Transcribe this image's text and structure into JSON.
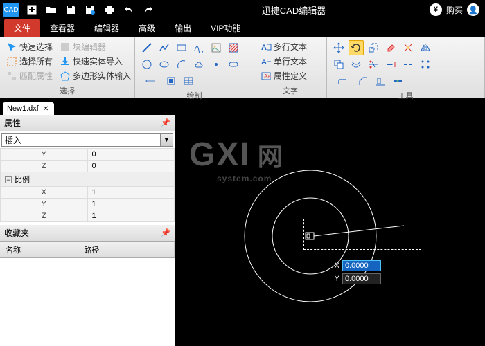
{
  "app": {
    "title": "迅捷CAD编辑器",
    "logo_text": "CAD",
    "buy": "购买"
  },
  "menu": {
    "tabs": [
      "文件",
      "查看器",
      "编辑器",
      "高级",
      "输出",
      "VIP功能"
    ],
    "active_index": 0
  },
  "ribbon": {
    "groups": {
      "select": {
        "label": "选择",
        "items": [
          "快速选择",
          "选择所有",
          "匹配属性",
          "块编辑器",
          "快速实体导入",
          "多边形实体输入"
        ]
      },
      "draw": {
        "label": "绘制"
      },
      "text": {
        "label": "文字",
        "items": [
          "多行文本",
          "单行文本",
          "属性定义"
        ]
      },
      "tools": {
        "label": "工具"
      }
    }
  },
  "filetab": {
    "name": "New1.dxf"
  },
  "panels": {
    "props": {
      "title": "属性",
      "combo": "插入"
    },
    "fav": {
      "title": "收藏夹",
      "col1": "名称",
      "col2": "路径"
    }
  },
  "props_rows": [
    {
      "k": "Y",
      "v": "0"
    },
    {
      "k": "Z",
      "v": "0"
    },
    {
      "section": "比例"
    },
    {
      "k": "X",
      "v": "1"
    },
    {
      "k": "Y",
      "v": "1"
    },
    {
      "k": "Z",
      "v": "1"
    }
  ],
  "coords": {
    "x_label": "X",
    "y_label": "Y",
    "x": "0.0000",
    "y": "0.0000"
  },
  "watermark": {
    "main": "GXI",
    "net": "网",
    "sub": "system.com"
  }
}
